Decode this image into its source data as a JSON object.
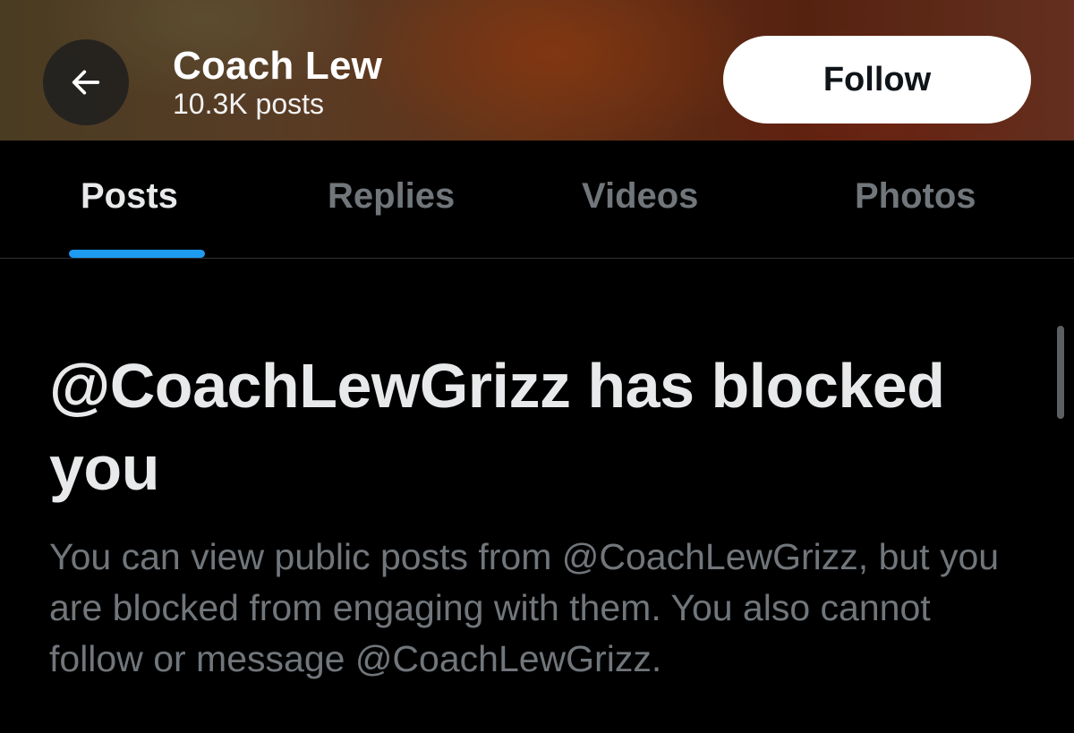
{
  "header": {
    "title": "Coach Lew",
    "post_count": "10.3K posts",
    "follow_label": "Follow",
    "back_icon": "arrow-left-icon"
  },
  "tabs": [
    {
      "label": "Posts",
      "active": true
    },
    {
      "label": "Replies",
      "active": false
    },
    {
      "label": "Videos",
      "active": false
    },
    {
      "label": "Photos",
      "active": false
    }
  ],
  "blocked": {
    "headline": "@CoachLewGrizz has blocked you",
    "message": "You can view public posts from @CoachLewGrizz, but you are blocked from engaging with them. You also cannot follow or message @CoachLewGrizz."
  },
  "colors": {
    "background": "#000000",
    "accent": "#1d9bf0",
    "muted_text": "#71767b",
    "primary_text": "#e7e9ea"
  }
}
